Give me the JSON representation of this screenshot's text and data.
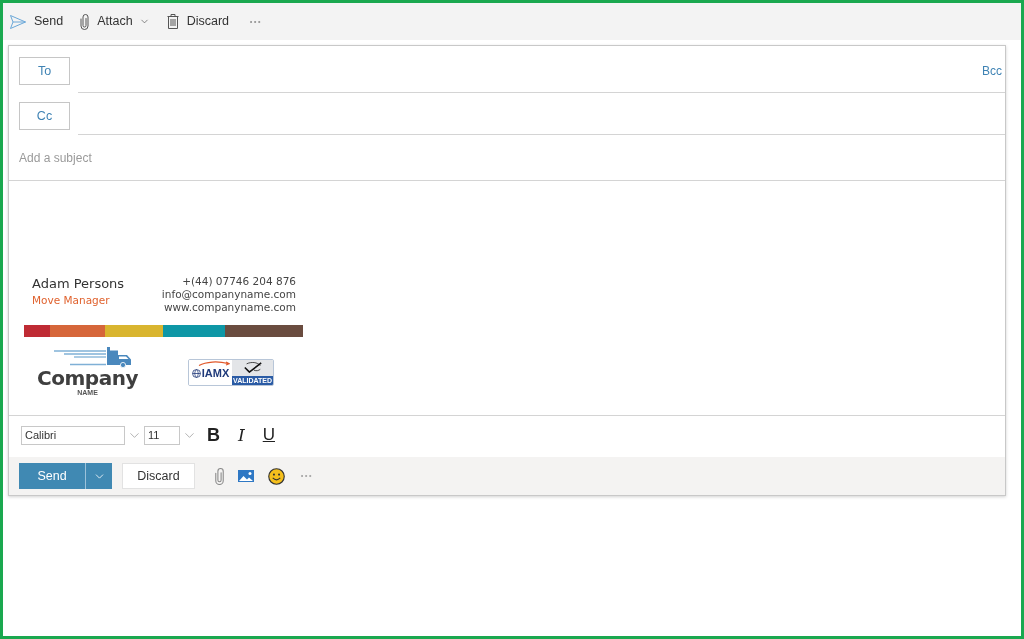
{
  "toolbar": {
    "actions": [
      {
        "kind": "send",
        "label": "Send",
        "menu": false
      },
      {
        "kind": "attach",
        "label": "Attach",
        "menu": true
      },
      {
        "kind": "discard",
        "label": "Discard",
        "menu": false
      }
    ]
  },
  "recipients": [
    {
      "label": "To",
      "bcc": "Bcc"
    },
    {
      "label": "Cc"
    }
  ],
  "subject": {
    "placeholder": "Add a subject"
  },
  "signature": {
    "name": "Adam Persons",
    "title": "Move Manager",
    "phone": "+(44) 07746 204 876",
    "email": "info@companyname.com",
    "website": "www.companyname.com",
    "logo": {
      "wordmark": "Company",
      "tagline": "NAME"
    },
    "badge": {
      "brand": "IAMX",
      "caption": "VALIDATED"
    }
  },
  "formatting": {
    "font": "Calibri",
    "size": "11",
    "buttons": [
      {
        "kind": "bold",
        "label": "B"
      },
      {
        "kind": "italic",
        "label": "I"
      },
      {
        "kind": "underline",
        "label": "U"
      }
    ]
  },
  "footer": {
    "send": "Send",
    "discard": "Discard"
  }
}
